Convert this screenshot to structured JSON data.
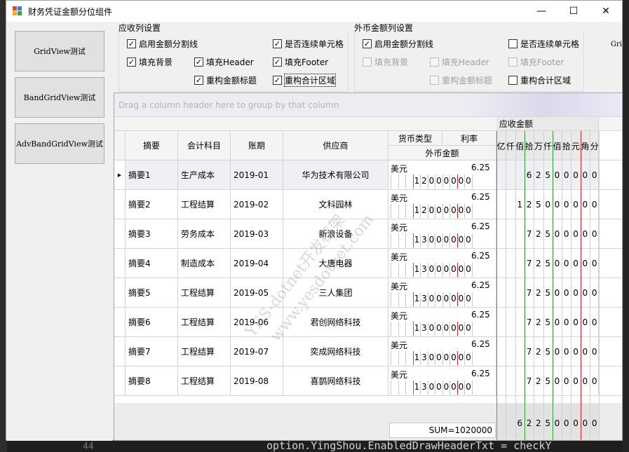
{
  "window": {
    "title": "财务凭证金额分位组件",
    "minimize": "—",
    "maximize": "☐",
    "close": "✕"
  },
  "nav": [
    {
      "label": "GridView测试"
    },
    {
      "label": "BandGridView测试"
    },
    {
      "label": "AdvBandGridView测试"
    }
  ],
  "receivable_settings": {
    "title": "应收列设置",
    "options": [
      {
        "label": "启用金额分割线",
        "checked": true,
        "enabled": true
      },
      {
        "label": "是否连续单元格",
        "checked": true,
        "enabled": true
      },
      {
        "label": "填充背景",
        "checked": true,
        "enabled": true
      },
      {
        "label": "填充Header",
        "checked": true,
        "enabled": true
      },
      {
        "label": "填充Footer",
        "checked": true,
        "enabled": true
      },
      {
        "label": "重构金额标题",
        "checked": true,
        "enabled": true
      },
      {
        "label": "重构合计区域",
        "checked": true,
        "enabled": true
      }
    ]
  },
  "foreign_settings": {
    "title": "外币金额列设置",
    "options": [
      {
        "label": "启用金额分割线",
        "checked": true,
        "enabled": true
      },
      {
        "label": "是否连续单元格",
        "checked": false,
        "enabled": true
      },
      {
        "label": "填充背景",
        "checked": false,
        "enabled": false
      },
      {
        "label": "填充Header",
        "checked": false,
        "enabled": false
      },
      {
        "label": "填充Footer",
        "checked": false,
        "enabled": false
      },
      {
        "label": "重构金额标题",
        "checked": false,
        "enabled": false
      },
      {
        "label": "重构合计区域",
        "checked": false,
        "enabled": true
      }
    ]
  },
  "side_label": "Gri",
  "grid": {
    "group_panel_text": "Drag a column header here to group by that column",
    "band_receivable": "应收金额",
    "band_currency_type": "货币类型",
    "band_rate": "利率",
    "band_foreign_amount": "外币金额",
    "columns": [
      "摘要",
      "会计科目",
      "账期",
      "供应商"
    ],
    "unit_headers": [
      "亿",
      "仟",
      "佰",
      "拾",
      "万",
      "仟",
      "佰",
      "拾",
      "元",
      "角",
      "分"
    ],
    "rows": [
      {
        "summary": "摘要1",
        "account": "生产成本",
        "period": "2019-01",
        "supplier": "华为技术有限公司",
        "currency": "美元",
        "rate": "6.25",
        "foreign_digits": [
          "",
          "",
          "",
          "1",
          "2",
          "0",
          "0",
          "0",
          "0",
          "0",
          "0"
        ],
        "amount_digits": [
          "",
          "",
          "",
          "6",
          "2",
          "5",
          "0",
          "0",
          "0",
          "0",
          "0"
        ]
      },
      {
        "summary": "摘要2",
        "account": "工程结算",
        "period": "2019-02",
        "supplier": "文科园林",
        "currency": "美元",
        "rate": "6.25",
        "foreign_digits": [
          "",
          "",
          "",
          "1",
          "2",
          "0",
          "0",
          "0",
          "0",
          "0",
          "0"
        ],
        "amount_digits": [
          "",
          "",
          "1",
          "2",
          "5",
          "0",
          "0",
          "0",
          "0",
          "0",
          "0"
        ]
      },
      {
        "summary": "摘要3",
        "account": "劳务成本",
        "period": "2019-03",
        "supplier": "新浪设备",
        "currency": "美元",
        "rate": "6.25",
        "foreign_digits": [
          "",
          "",
          "",
          "1",
          "3",
          "0",
          "0",
          "0",
          "0",
          "0",
          "0"
        ],
        "amount_digits": [
          "",
          "",
          "",
          "7",
          "2",
          "5",
          "0",
          "0",
          "0",
          "0",
          "0"
        ]
      },
      {
        "summary": "摘要4",
        "account": "制造成本",
        "period": "2019-04",
        "supplier": "大唐电器",
        "currency": "美元",
        "rate": "6.25",
        "foreign_digits": [
          "",
          "",
          "",
          "1",
          "3",
          "0",
          "0",
          "0",
          "0",
          "0",
          "0"
        ],
        "amount_digits": [
          "",
          "",
          "",
          "7",
          "2",
          "5",
          "0",
          "0",
          "0",
          "0",
          "0"
        ]
      },
      {
        "summary": "摘要5",
        "account": "工程结算",
        "period": "2019-05",
        "supplier": "三人集团",
        "currency": "美元",
        "rate": "6.25",
        "foreign_digits": [
          "",
          "",
          "",
          "1",
          "3",
          "0",
          "0",
          "0",
          "0",
          "0",
          "0"
        ],
        "amount_digits": [
          "",
          "",
          "",
          "7",
          "2",
          "5",
          "0",
          "0",
          "0",
          "0",
          "0"
        ]
      },
      {
        "summary": "摘要6",
        "account": "工程结算",
        "period": "2019-06",
        "supplier": "君创网络科技",
        "currency": "美元",
        "rate": "6.25",
        "foreign_digits": [
          "",
          "",
          "",
          "1",
          "3",
          "0",
          "0",
          "0",
          "0",
          "0",
          "0"
        ],
        "amount_digits": [
          "",
          "",
          "",
          "7",
          "2",
          "5",
          "0",
          "0",
          "0",
          "0",
          "0"
        ]
      },
      {
        "summary": "摘要7",
        "account": "工程结算",
        "period": "2019-07",
        "supplier": "奕成网络科技",
        "currency": "美元",
        "rate": "6.25",
        "foreign_digits": [
          "",
          "",
          "",
          "1",
          "3",
          "0",
          "0",
          "0",
          "0",
          "0",
          "0"
        ],
        "amount_digits": [
          "",
          "",
          "",
          "7",
          "2",
          "5",
          "0",
          "0",
          "0",
          "0",
          "0"
        ]
      },
      {
        "summary": "摘要8",
        "account": "工程结算",
        "period": "2019-08",
        "supplier": "喜鹊网络科技",
        "currency": "美元",
        "rate": "6.25",
        "foreign_digits": [
          "",
          "",
          "",
          "1",
          "3",
          "0",
          "0",
          "0",
          "0",
          "0",
          "0"
        ],
        "amount_digits": [
          "",
          "",
          "",
          "7",
          "2",
          "5",
          "0",
          "0",
          "0",
          "0",
          "0"
        ]
      }
    ],
    "footer_sum": "SUM=1020000",
    "footer_amount_digits": [
      "",
      "",
      "6",
      "2",
      "2",
      "5",
      "0",
      "0",
      "0",
      "0",
      "0"
    ]
  },
  "watermark": [
    "YES-dotnet开发框架",
    "www.yesdotnet.com"
  ],
  "background": {
    "code_line": "option.YingShou.EnabledDrawHeaderTxt = checkY",
    "line_number": "44"
  },
  "colors": {
    "separator_green": "#2e9b2e",
    "separator_red": "#e02020",
    "header_bg": "#f4f4f4",
    "band_shade": "#e9e9e9"
  }
}
